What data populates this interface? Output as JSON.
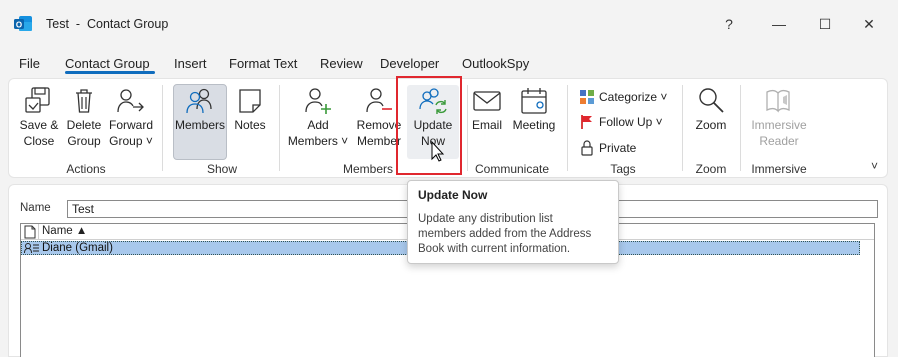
{
  "window": {
    "title": "Test  -  Contact Group",
    "help": "?",
    "minimize": "—",
    "maximize": "☐",
    "close": "✕"
  },
  "menu": {
    "tabs": [
      "File",
      "Contact Group",
      "Insert",
      "Format Text",
      "Review",
      "Developer",
      "OutlookSpy"
    ],
    "active_tab": "Contact Group"
  },
  "ribbon": {
    "actions": {
      "save_close": [
        "Save &",
        "Close"
      ],
      "delete_group": [
        "Delete",
        "Group"
      ],
      "forward_group": [
        "Forward",
        "Group ˅"
      ],
      "group_label": "Actions"
    },
    "show": {
      "members": "Members",
      "notes": "Notes",
      "group_label": "Show"
    },
    "members": {
      "add_members": [
        "Add",
        "Members ˅"
      ],
      "remove_member": [
        "Remove",
        "Member"
      ],
      "update_now": [
        "Update",
        "Now"
      ],
      "group_label": "Members"
    },
    "communicate": {
      "email": "Email",
      "meeting": "Meeting",
      "group_label": "Communicate"
    },
    "tags": {
      "categorize": "Categorize ˅",
      "follow_up": "Follow Up ˅",
      "private": "Private",
      "group_label": "Tags"
    },
    "zoom": {
      "zoom": "Zoom",
      "group_label": "Zoom"
    },
    "immersive": {
      "immersive_reader": [
        "Immersive",
        "Reader"
      ],
      "group_label": "Immersive"
    },
    "collapse": "˅"
  },
  "form": {
    "name_label": "Name",
    "name_value": "Test",
    "list_header": "Name ▲",
    "members": [
      "Diane (Gmail)"
    ]
  },
  "tooltip": {
    "title": "Update Now",
    "description": [
      "Update any distribution list",
      "members added from the Address",
      "Book with current information."
    ]
  },
  "colors": {
    "accent": "#0f6cbd",
    "highlight": "#e0272e",
    "selection": "#a8c8ec",
    "green": "#3a9a3a"
  }
}
